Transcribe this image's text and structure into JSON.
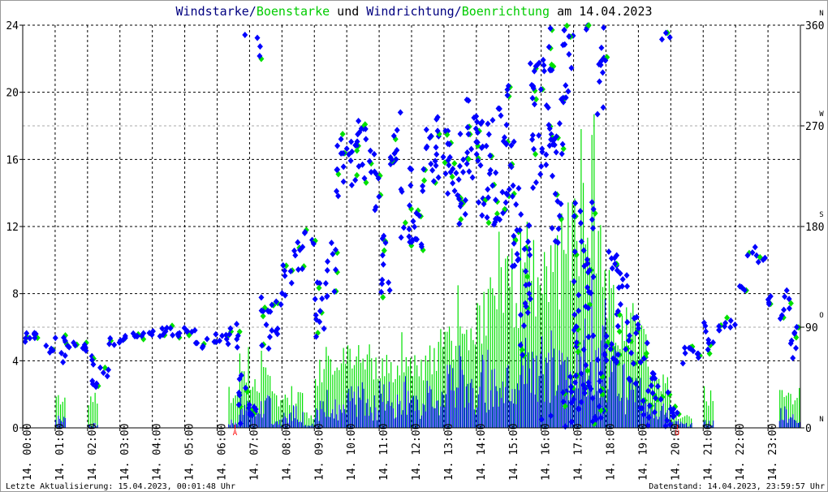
{
  "chart_data": {
    "type": "bar+scatter",
    "title_parts": [
      {
        "text": "Windstarke",
        "color": "#000080"
      },
      {
        "text": "/",
        "color": "#000080"
      },
      {
        "text": "Boenstarke",
        "color": "#00cc00"
      },
      {
        "text": " und ",
        "color": "#000000"
      },
      {
        "text": "Windrichtung",
        "color": "#000080"
      },
      {
        "text": "/",
        "color": "#000080"
      },
      {
        "text": "Boenrichtung",
        "color": "#00cc00"
      },
      {
        "text": " am 14.04.2023",
        "color": "#000000"
      }
    ],
    "left_axis": {
      "range": [
        0,
        24
      ],
      "ticks": [
        "0",
        "4",
        "8",
        "12",
        "16",
        "20",
        "24"
      ]
    },
    "right_axis": {
      "range": [
        0,
        360
      ],
      "ticks": [
        "0",
        "90",
        "180",
        "270",
        "360"
      ],
      "compass": [
        "N",
        "O",
        "S",
        "W",
        "N"
      ]
    },
    "x_ticks": [
      "14. 00:00",
      "14. 01:00",
      "14. 02:00",
      "14. 03:00",
      "14. 04:00",
      "14. 05:00",
      "14. 06:00",
      "14. 07:00",
      "14. 08:00",
      "14. 09:00",
      "14. 10:00",
      "14. 11:00",
      "14. 12:00",
      "14. 13:00",
      "14. 14:00",
      "14. 15:00",
      "14. 16:00",
      "14. 17:00",
      "14. 18:00",
      "14. 19:00",
      "14. 20:00",
      "14. 21:00",
      "14. 22:00",
      "14. 23:00"
    ],
    "x_range_hours": [
      0,
      24
    ],
    "interval_minutes": 20,
    "markers": [
      {
        "label": "A",
        "hour": 6.55
      },
      {
        "label": "U",
        "hour": 20.2
      }
    ],
    "colors": {
      "wind": "#0000ff",
      "gust": "#00e000",
      "marker": "#ff0000",
      "title_blue": "#000080"
    },
    "series": [
      {
        "name": "Windstarke",
        "values": [
          0,
          0,
          0,
          0.8,
          0,
          0,
          0.3,
          0,
          0,
          0,
          0,
          0,
          0,
          0,
          0,
          0,
          0,
          0,
          0,
          0.5,
          2,
          1.5,
          2,
          0.5,
          1,
          1.5,
          0.3,
          2,
          2.5,
          1.5,
          2.5,
          3,
          2,
          3,
          2.5,
          3.5,
          2,
          3,
          2.5,
          4,
          5,
          4,
          4.5,
          5,
          6,
          5,
          6.5,
          5.5,
          7,
          5,
          6,
          6,
          9,
          8,
          5,
          4,
          3.5,
          3,
          2,
          1.5,
          0.5,
          0.3,
          0,
          0.5,
          0,
          0,
          0,
          0,
          0,
          0,
          1.5,
          1
        ]
      },
      {
        "name": "Boenstarke",
        "values": [
          0,
          0,
          0,
          2.5,
          0,
          0,
          2.5,
          0,
          0,
          0,
          0,
          0,
          0,
          0,
          0,
          0,
          0,
          0,
          0,
          2.5,
          5,
          4,
          5,
          2.5,
          2.5,
          2.5,
          1,
          5,
          5,
          5,
          5,
          5,
          5,
          5,
          5,
          6,
          5,
          5,
          6,
          7.5,
          9,
          8,
          10,
          9,
          12,
          11,
          13,
          12,
          15,
          13,
          15,
          18,
          20,
          15,
          10,
          8,
          7.5,
          7,
          5,
          4,
          1,
          0.8,
          0,
          2.5,
          0,
          0,
          0,
          0,
          0,
          0,
          2.5,
          2.5
        ]
      },
      {
        "name": "Windrichtung",
        "values": [
          81,
          81,
          70,
          72,
          75,
          72,
          50,
          50,
          78,
          80,
          84,
          85,
          85,
          86,
          86,
          86,
          75,
          80,
          80,
          80,
          20,
          355,
          90,
          100,
          130,
          150,
          170,
          110,
          140,
          230,
          240,
          250,
          220,
          150,
          260,
          200,
          180,
          240,
          250,
          240,
          220,
          260,
          240,
          230,
          250,
          200,
          130,
          270,
          300,
          230,
          350,
          110,
          100,
          350,
          110,
          100,
          80,
          40,
          20,
          10,
          12,
          65,
          65,
          82,
          90,
          92,
          125,
          158,
          150,
          114,
          110,
          75
        ]
      }
    ]
  },
  "footer": {
    "left": "Letzte Aktualisierung: 15.04.2023, 00:01:48 Uhr",
    "right": "Datenstand: 14.04.2023, 23:59:57 Uhr"
  }
}
